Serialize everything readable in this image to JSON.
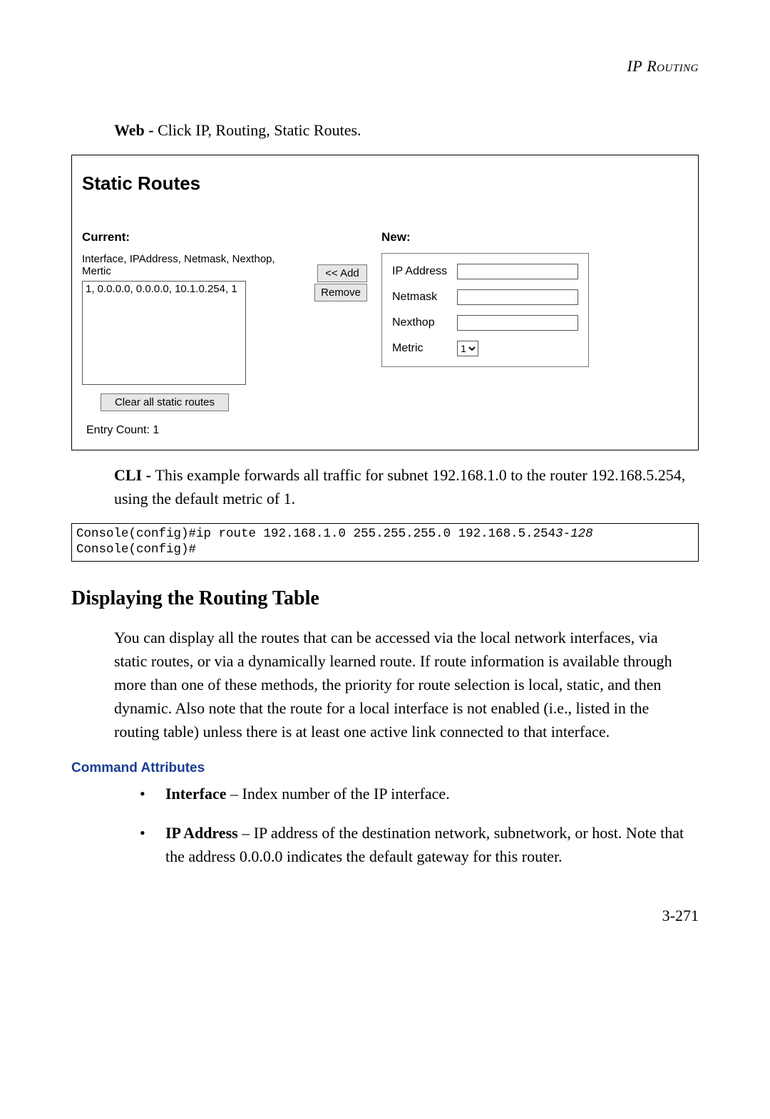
{
  "header": {
    "title_prefix": "IP",
    "title_word": " Routing"
  },
  "intro": {
    "web_label": "Web - ",
    "web_text": "Click IP, Routing, Static Routes."
  },
  "static_routes": {
    "title": "Static Routes",
    "current_label": "Current:",
    "list_header": "Interface, IPAddress, Netmask, Nexthop, Mertic",
    "list_entry": "1, 0.0.0.0, 0.0.0.0, 10.1.0.254, 1",
    "add_button": "<< Add",
    "remove_button": "Remove",
    "new_label": "New:",
    "fields": {
      "ip_address_label": "IP Address",
      "netmask_label": "Netmask",
      "nexthop_label": "Nexthop",
      "metric_label": "Metric",
      "metric_value": "1"
    },
    "clear_button": "Clear all static routes",
    "entry_count": "Entry Count: 1"
  },
  "cli": {
    "label": "CLI - ",
    "text": "This example forwards all traffic for subnet 192.168.1.0 to the router 192.168.5.254, using the default metric of 1.",
    "line1_left": "Console(config)#ip route 192.168.1.0 255.255.255.0 192.168.5.254",
    "line1_em": "3-128",
    "line2": "Console(config)#"
  },
  "routing_table": {
    "heading": "Displaying the Routing Table",
    "paragraph": "You can display all the routes that can be accessed via the local network interfaces, via static routes, or via a dynamically learned route. If route information is available through more than one of these methods, the priority for route selection is local, static, and then dynamic. Also note that the route for a local interface is not enabled (i.e., listed in the routing table) unless there is at least one active link connected to that interface.",
    "cmd_attr_heading": "Command Attributes",
    "attrs": [
      {
        "name": "Interface",
        "desc": " – Index number of the IP interface."
      },
      {
        "name": "IP Address",
        "desc": " – IP address of the destination network, subnetwork, or host. Note that the address 0.0.0.0 indicates the default gateway for this router."
      }
    ]
  },
  "page_number": "3-271"
}
